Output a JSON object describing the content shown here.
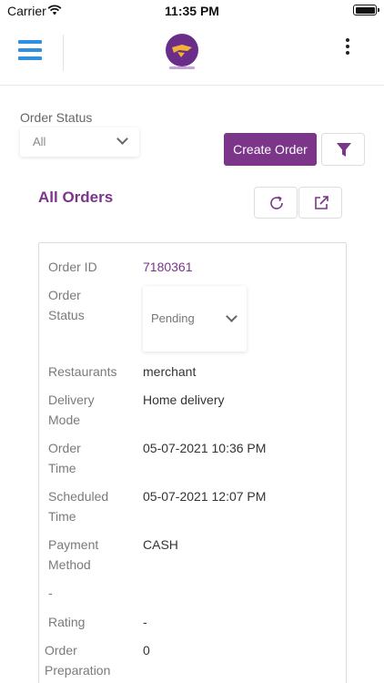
{
  "status_bar": {
    "carrier": "Carrier",
    "time": "11:35 PM"
  },
  "header": {
    "menu_icon": "hamburger-menu-icon",
    "logo": "brand-logo",
    "more_icon": "more-vertical-icon",
    "brand_color": "#7b3589",
    "menu_color": "#2f8fe0"
  },
  "filters": {
    "order_status_label": "Order Status",
    "order_status_value": "All",
    "create_order_label": "Create Order",
    "filter_icon": "filter-icon"
  },
  "orders": {
    "title": "All Orders",
    "refresh_icon": "refresh-icon",
    "export_icon": "external-link-icon"
  },
  "order": {
    "order_id_label": "Order ID",
    "order_id_value": "7180361",
    "order_status_label_1": "Order",
    "order_status_label_2": "Status",
    "order_status_value": "Pending",
    "restaurants_label": "Restaurants",
    "restaurants_value": "merchant",
    "delivery_mode_label_1": "Delivery",
    "delivery_mode_label_2": "Mode",
    "delivery_mode_value": "Home delivery",
    "order_time_label_1": "Order",
    "order_time_label_2": "Time",
    "order_time_value": "05-07-2021 10:36 PM",
    "scheduled_time_label_1": "Scheduled",
    "scheduled_time_label_2": "Time",
    "scheduled_time_value": "05-07-2021 12:07 PM",
    "payment_method_label_1": "Payment",
    "payment_method_label_2": "Method",
    "payment_method_value": "CASH",
    "dash_label": "-",
    "rating_label": "Rating",
    "rating_value": "-",
    "order_preparation_label_1": "Order",
    "order_preparation_label_2": "Preparation",
    "order_preparation_value": "0"
  }
}
